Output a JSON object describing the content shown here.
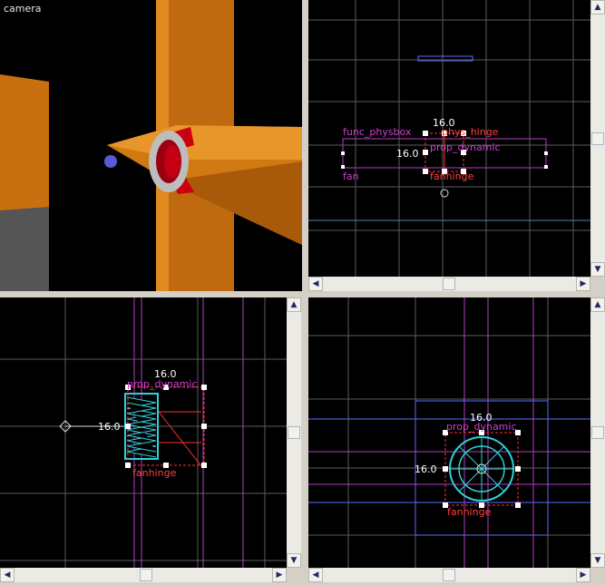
{
  "camera_view": {
    "label": "camera"
  },
  "top_view": {
    "labels": {
      "func_physbox": "func_physbox",
      "phys_hinge": "phys_hinge",
      "prop_dynamic": "prop_dynamic",
      "fan": "fan",
      "fanhinge": "fanhinge",
      "width": "16.0",
      "height": "16.0"
    }
  },
  "side_view": {
    "labels": {
      "prop_dynamic": "prop_dynamic",
      "fanhinge": "fanhinge",
      "width": "16.0",
      "height": "16.0"
    }
  },
  "front_view": {
    "labels": {
      "prop_dynamic": "prop_dynamic",
      "fanhinge": "fanhinge",
      "width": "16.0",
      "height": "16.0"
    }
  },
  "colors": {
    "grid": "#6e6e6e",
    "selection": "#ff3030",
    "entity_label": "#d040d0",
    "brush_cyan": "#30d0d8",
    "handle": "#ffffff"
  },
  "icons": {
    "scroll_up": "▲",
    "scroll_down": "▼",
    "scroll_left": "◀",
    "scroll_right": "▶"
  }
}
